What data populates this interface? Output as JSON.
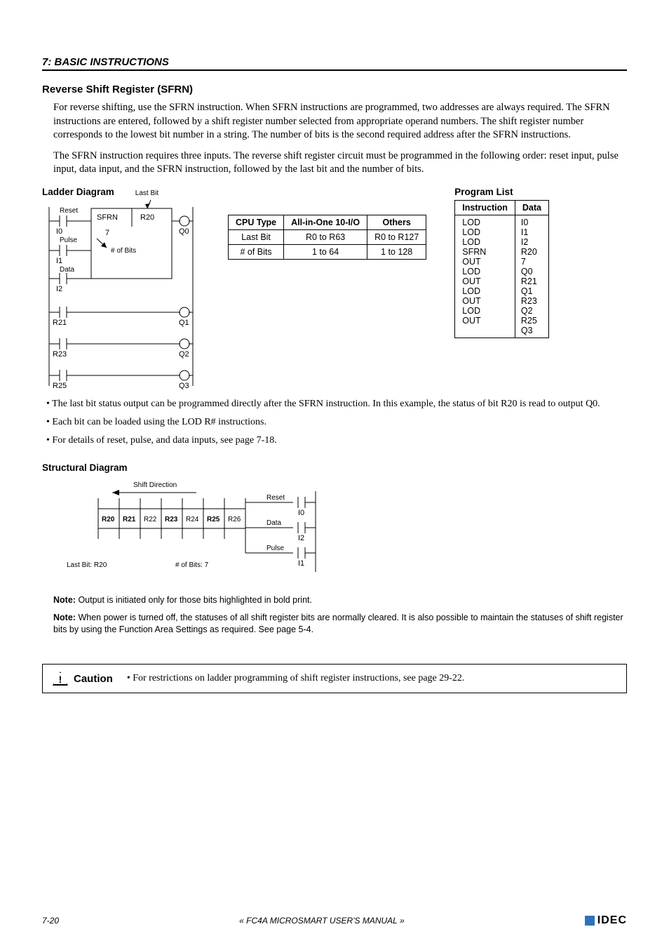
{
  "header": {
    "chapter": "7: BASIC INSTRUCTIONS"
  },
  "title": "Reverse Shift Register (SFRN)",
  "paragraphs": {
    "p1": "For reverse shifting, use the SFRN instruction. When SFRN instructions are programmed, two addresses are always required. The SFRN instructions are entered, followed by a shift register number selected from appropriate operand numbers. The shift register number corresponds to the lowest bit number in a string. The number of bits is the second required address after the SFRN instructions.",
    "p2": "The SFRN instruction requires three inputs. The reverse shift register circuit must be programmed in the following order: reset input, pulse input, data input, and the SFRN instruction, followed by the last bit and the number of bits."
  },
  "ladder": {
    "title": "Ladder Diagram",
    "labels": {
      "lastbit": "Last Bit",
      "reset": "Reset",
      "pulse": "Pulse",
      "data": "Data",
      "sfrn": "SFRN",
      "r20": "R20",
      "seven": "7",
      "numbits": "# of Bits",
      "i0": "I0",
      "i1": "I1",
      "i2": "I2",
      "q0": "Q0",
      "q1": "Q1",
      "q2": "Q2",
      "q3": "Q3",
      "r21": "R21",
      "r23": "R23",
      "r25": "R25"
    }
  },
  "cpu_table": {
    "headers": {
      "type": "CPU Type",
      "aio": "All-in-One 10-I/O",
      "others": "Others"
    },
    "rows": [
      {
        "type": "Last Bit",
        "aio": "R0 to R63",
        "others": "R0 to R127"
      },
      {
        "type": "# of Bits",
        "aio": "1 to 64",
        "others": "1 to 128"
      }
    ]
  },
  "program_list": {
    "title": "Program List",
    "headers": {
      "instr": "Instruction",
      "data": "Data"
    },
    "rows": [
      {
        "instr": "LOD",
        "data": "I0"
      },
      {
        "instr": "LOD",
        "data": "I1"
      },
      {
        "instr": "LOD",
        "data": "I2"
      },
      {
        "instr": "SFRN",
        "data": "R20"
      },
      {
        "instr": "",
        "data": "7"
      },
      {
        "instr": "OUT",
        "data": "Q0"
      },
      {
        "instr": "LOD",
        "data": "R21"
      },
      {
        "instr": "OUT",
        "data": "Q1"
      },
      {
        "instr": "LOD",
        "data": "R23"
      },
      {
        "instr": "OUT",
        "data": "Q2"
      },
      {
        "instr": "LOD",
        "data": "R25"
      },
      {
        "instr": "OUT",
        "data": "Q3"
      }
    ]
  },
  "bullets": {
    "b1": "The last bit status output can be programmed directly after the SFRN instruction. In this example, the status of bit R20 is read to output Q0.",
    "b2": "Each bit can be loaded using the LOD R# instructions.",
    "b3": "For details of reset, pulse, and data inputs, see page 7-18."
  },
  "struct": {
    "title": "Structural Diagram",
    "labels": {
      "shiftdir": "Shift Direction",
      "reset": "Reset",
      "data": "Data",
      "pulse": "Pulse",
      "i0": "I0",
      "i1": "I1",
      "i2": "I2",
      "lastbit": "Last Bit: R20",
      "numbits": "# of Bits: 7",
      "cells": [
        "R20",
        "R21",
        "R22",
        "R23",
        "R24",
        "R25",
        "R26"
      ]
    }
  },
  "notes": {
    "n1_label": "Note:",
    "n1": "Output is initiated only for those bits highlighted in bold print.",
    "n2_label": "Note:",
    "n2": "When power is turned off, the statuses of all shift register bits are normally cleared. It is also possible to maintain the statuses of shift register bits by using the Function Area Settings as required. See page 5-4."
  },
  "caution": {
    "label": "Caution",
    "text": "For restrictions on ladder programming of shift register instructions, see page 29-22."
  },
  "footer": {
    "page": "7-20",
    "manual": "« FC4A MICROSMART USER'S MANUAL »",
    "logo": "IDEC"
  }
}
